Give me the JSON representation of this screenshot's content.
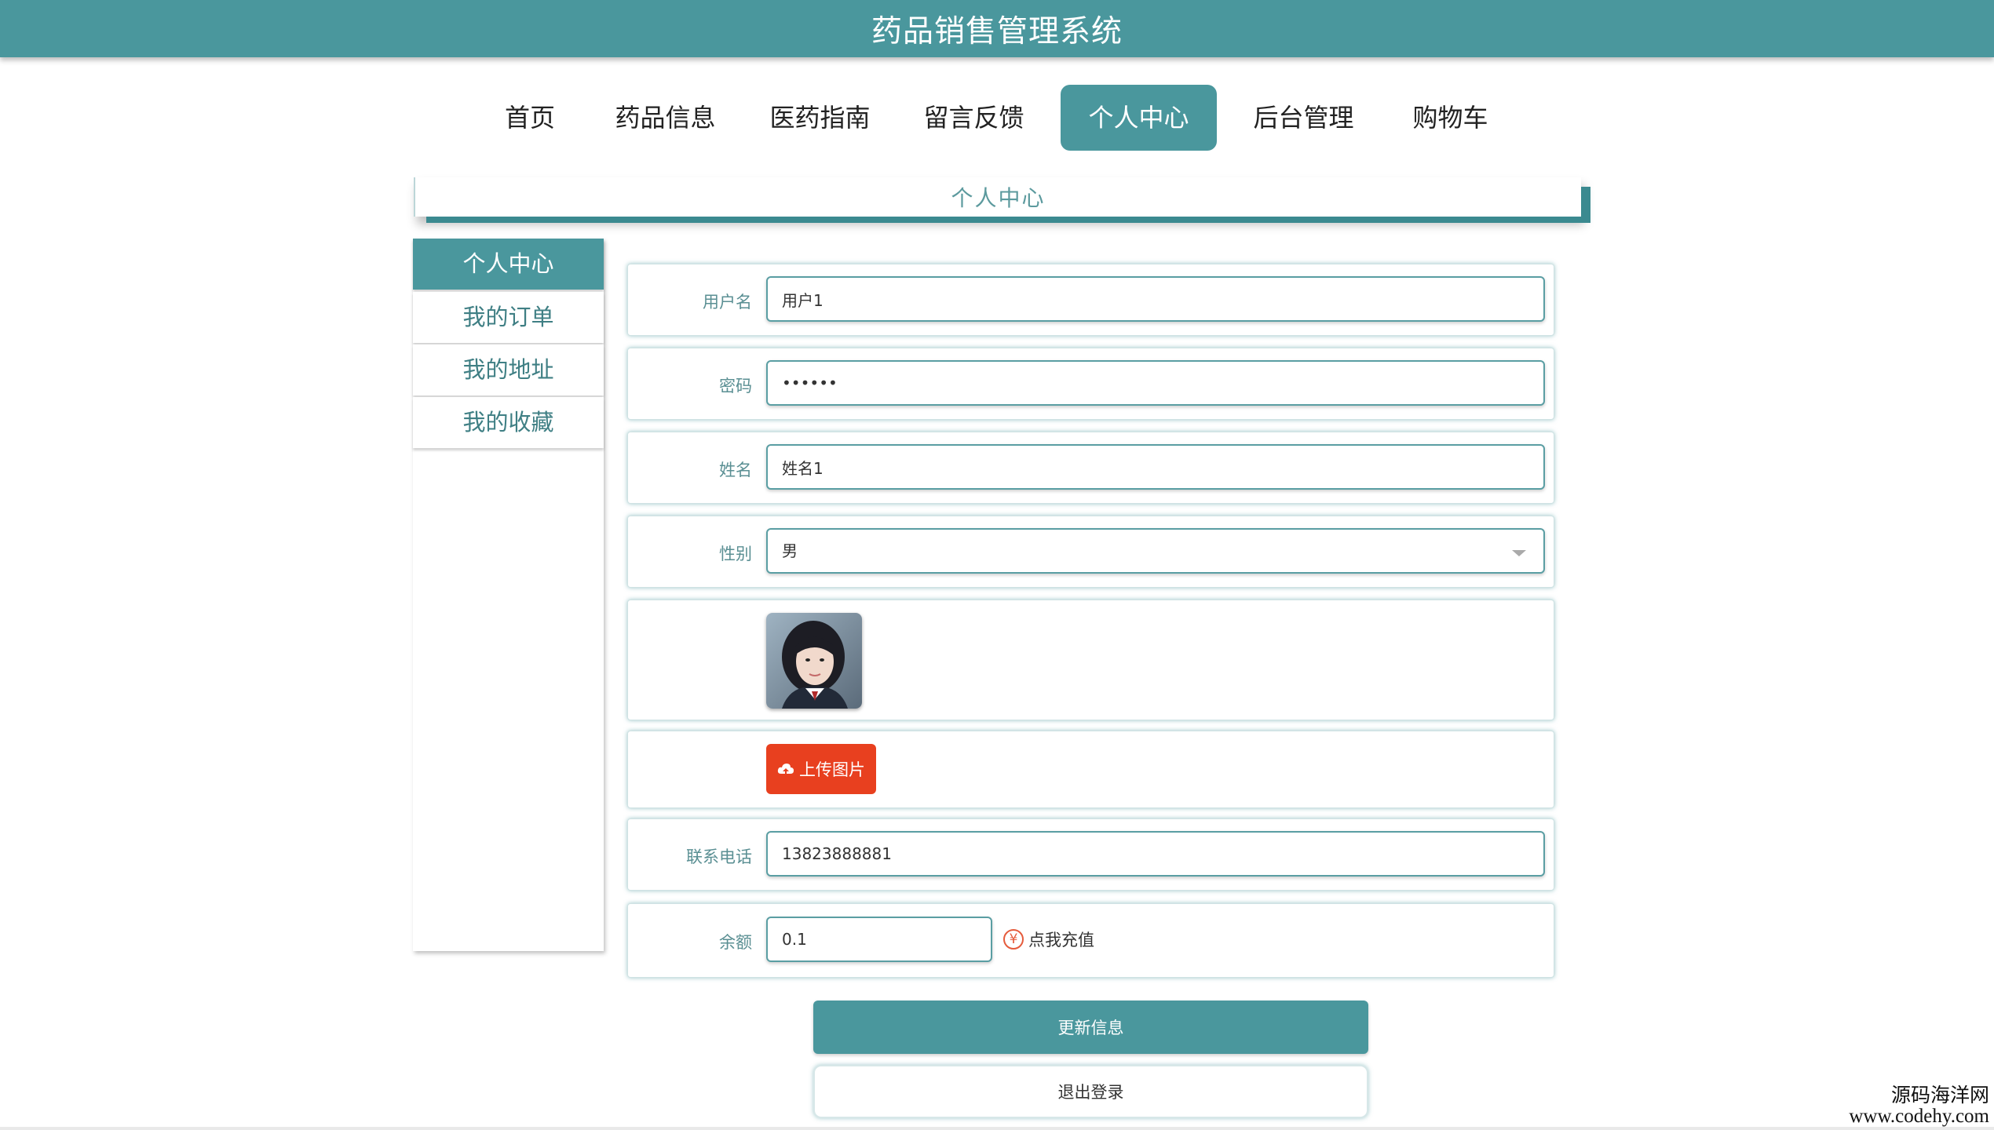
{
  "app": {
    "title": "药品销售管理系统"
  },
  "nav": {
    "items": [
      {
        "label": "首页"
      },
      {
        "label": "药品信息"
      },
      {
        "label": "医药指南"
      },
      {
        "label": "留言反馈"
      },
      {
        "label": "个人中心",
        "active": true
      },
      {
        "label": "后台管理"
      },
      {
        "label": "购物车"
      }
    ]
  },
  "section": {
    "title": "个人中心"
  },
  "sidebar": {
    "items": [
      {
        "label": "个人中心",
        "active": true
      },
      {
        "label": "我的订单"
      },
      {
        "label": "我的地址"
      },
      {
        "label": "我的收藏"
      }
    ]
  },
  "form": {
    "username": {
      "label": "用户名",
      "value": "用户1"
    },
    "password": {
      "label": "密码",
      "value": "123456"
    },
    "name": {
      "label": "姓名",
      "value": "姓名1"
    },
    "gender": {
      "label": "性别",
      "value": "男"
    },
    "avatar": {
      "icon": "user-avatar-photo"
    },
    "upload": {
      "label": "上传图片",
      "icon": "cloud-upload-icon"
    },
    "phone": {
      "label": "联系电话",
      "value": "13823888881"
    },
    "balance": {
      "label": "余额",
      "value": "0.1",
      "recharge_label": "点我充值",
      "recharge_icon": "yen-icon"
    }
  },
  "actions": {
    "update_label": "更新信息",
    "logout_label": "退出登录"
  },
  "watermark": {
    "line1": "源码海洋网",
    "line2": "www.codehy.com"
  },
  "colors": {
    "accent": "#4a979d",
    "upload": "#e8401f"
  }
}
